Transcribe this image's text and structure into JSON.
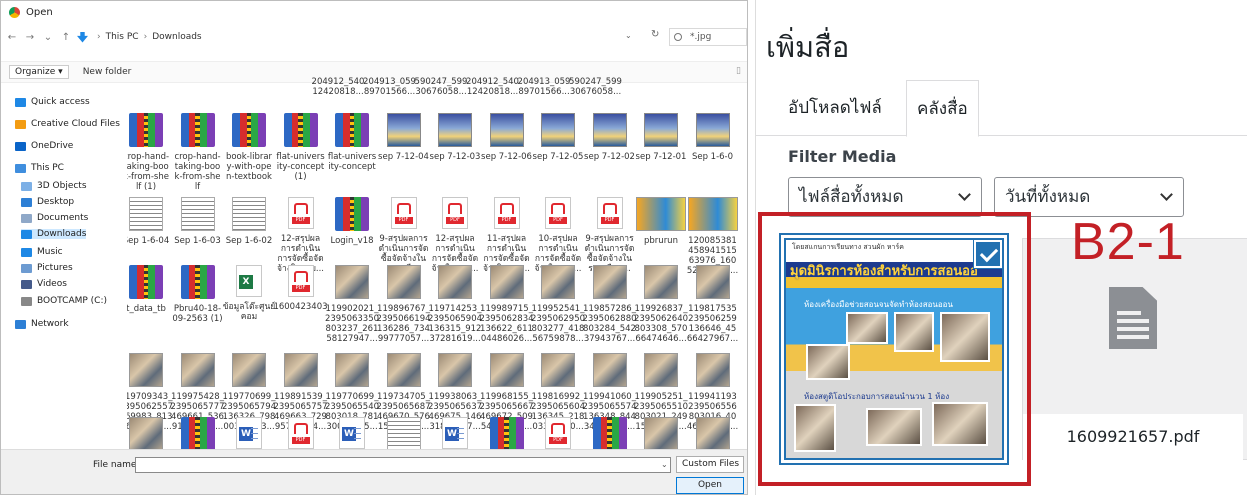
{
  "dialog": {
    "title": "Open",
    "address": [
      "This PC",
      "Downloads"
    ],
    "search_placeholder": "*.jpg",
    "organize": "Organize ▾",
    "new_folder": "New folder",
    "file_name_label": "File name:",
    "file_name_value": "",
    "file_type": "Custom Files",
    "open_button": "Open"
  },
  "nav": [
    {
      "label": "Quick access",
      "icon": "star-icon",
      "color": "#1e88e5"
    },
    {
      "label": "Creative Cloud Files",
      "icon": "cloud-files-icon",
      "color": "#f39c12"
    },
    {
      "label": "OneDrive",
      "icon": "onedrive-icon",
      "color": "#0a64c8"
    },
    {
      "label": "This PC",
      "icon": "computer-icon",
      "color": "#3f8ede"
    },
    {
      "label": "3D Objects",
      "icon": "cube-icon",
      "color": "#7db0e6"
    },
    {
      "label": "Desktop",
      "icon": "desktop-icon",
      "color": "#2d7fd5"
    },
    {
      "label": "Documents",
      "icon": "documents-icon",
      "color": "#8fa8c8"
    },
    {
      "label": "Downloads",
      "icon": "downloads-icon",
      "color": "#1e88e5"
    },
    {
      "label": "Music",
      "icon": "music-icon",
      "color": "#1e88e5"
    },
    {
      "label": "Pictures",
      "icon": "pictures-icon",
      "color": "#6d9bd1"
    },
    {
      "label": "Videos",
      "icon": "videos-icon",
      "color": "#455a8a"
    },
    {
      "label": "BOOTCAMP (C:)",
      "icon": "drive-icon",
      "color": "#888888"
    },
    {
      "label": "Network",
      "icon": "network-icon",
      "color": "#2d7fd5"
    }
  ],
  "files_top_partial": [
    "204912_540\n12420818...",
    "204913_059\n89701566...",
    "590247_599\n30676058...",
    "204912_540\n12420818...",
    "204913_059\n89701566...",
    "590247_599\n30676058..."
  ],
  "files": [
    [
      {
        "name": "crop-hand-\ntaking-boo\nk-from-she\nlf (1)",
        "type": "rar"
      },
      {
        "name": "crop-hand-\ntaking-boo\nk-from-she\nlf",
        "type": "rar"
      },
      {
        "name": "book-librar\ny-with-ope\nn-textbook",
        "type": "rar"
      },
      {
        "name": "flat-univers\nity-concept\n(1)",
        "type": "rar"
      },
      {
        "name": "flat-univers\nity-concept",
        "type": "rar"
      },
      {
        "name": "sep 7-12-04",
        "type": "poster"
      },
      {
        "name": "sep 7-12-03",
        "type": "poster"
      },
      {
        "name": "sep 7-12-06",
        "type": "poster"
      },
      {
        "name": "sep 7-12-05",
        "type": "poster"
      },
      {
        "name": "sep 7-12-02",
        "type": "poster"
      },
      {
        "name": "sep 7-12-01",
        "type": "poster"
      },
      {
        "name": "Sep 1-6-0",
        "type": "poster"
      }
    ],
    [
      {
        "name": "Sep 1-6-04",
        "type": "doc"
      },
      {
        "name": "Sep 1-6-03",
        "type": "doc"
      },
      {
        "name": "Sep 1-6-02",
        "type": "doc"
      },
      {
        "name": "12-สรุปผล\nการดำเนิน\nการจัดซื้อจัด\nจ้างในรอบ...",
        "type": "pdf"
      },
      {
        "name": "Login_v18",
        "type": "rar"
      },
      {
        "name": "9-สรุปผลการ\nดำเนินการจัด\nซื้อจัดจ้างใน\nรอบเดื...",
        "type": "pdf"
      },
      {
        "name": "12-สรุปผล\nการดำเนิน\nการจัดซื้อจัด\nจ้างในรอบ...",
        "type": "pdf"
      },
      {
        "name": "11-สรุปผล\nการดำเนิน\nการจัดซื้อจัด\nจ้างในรอบ...",
        "type": "pdf"
      },
      {
        "name": "10-สรุปผล\nการดำเนิน\nการจัดซื้อจัด\nจ้างในรอบ...",
        "type": "pdf"
      },
      {
        "name": "9-สรุปผลการ\nดำเนินการจัด\nซื้อจัดจ้างใน\nรอบเดือน...",
        "type": "pdf"
      },
      {
        "name": "pbrurun",
        "type": "banner"
      },
      {
        "name": "120085381\n458941515\n63976_160\n52236138...",
        "type": "banner"
      }
    ],
    [
      {
        "name": "t_data_tb",
        "type": "rar"
      },
      {
        "name": "Pbru40-18-\n09-2563 (1)",
        "type": "rar"
      },
      {
        "name": "ข้อมูลโต๊ะศูนย์\nคอม",
        "type": "excel"
      },
      {
        "name": "1600423403",
        "type": "pdf"
      },
      {
        "name": "119902021_\n2395063350\n803237_261\n58127947...",
        "type": "photo"
      },
      {
        "name": "119896767_\n2395066194\n136286_734\n99777057...",
        "type": "photo"
      },
      {
        "name": "119714253_\n2395065904\n136315_912\n37281619...",
        "type": "photo"
      },
      {
        "name": "119989715_\n2395062834\n136622_611\n04486026...",
        "type": "photo"
      },
      {
        "name": "119952541_\n2395062950\n803277_418\n56759878...",
        "type": "photo"
      },
      {
        "name": "119857286_\n2395062880\n803284_542\n37943767...",
        "type": "photo"
      },
      {
        "name": "119926837_\n2395062640\n803308_570\n66474646...",
        "type": "photo"
      },
      {
        "name": "119817535\n239506259\n136646_45\n66427967...",
        "type": "photo"
      }
    ],
    [
      {
        "name": "119709343_\n2395062557\n469983_813\n46101238...",
        "type": "photo"
      },
      {
        "name": "119975428_\n2395065777\n469661_536\n91043635...",
        "type": "photo"
      },
      {
        "name": "119770699_\n2395065794\n136326_798\n00336293...",
        "type": "photo"
      },
      {
        "name": "119891539_\n2395065757\n469663_729\n95788224...",
        "type": "photo"
      },
      {
        "name": "119770699_\n2395065540\n803018_781\n30004555...",
        "type": "photo"
      },
      {
        "name": "119734705_\n2395065687\n469670_576\n15368216...",
        "type": "photo"
      },
      {
        "name": "119938063_\n2395065637\n469675_146\n31880837...",
        "type": "photo"
      },
      {
        "name": "119968155_\n2395065667\n469672_509\n54271096...",
        "type": "photo"
      },
      {
        "name": "119816992_\n2395065604\n136345_218\n03313450...",
        "type": "photo"
      },
      {
        "name": "119941060_\n2395065574\n136348_844\n34182650...",
        "type": "photo"
      },
      {
        "name": "119905251_\n2395065510\n803021_249\n15874061...",
        "type": "photo"
      },
      {
        "name": "119941193\n239506556\n803016_40\n46117992...",
        "type": "photo"
      }
    ],
    [
      {
        "name": "",
        "type": "photo"
      },
      {
        "name": "",
        "type": "rar"
      },
      {
        "name": "",
        "type": "word"
      },
      {
        "name": "",
        "type": "pdf"
      },
      {
        "name": "",
        "type": "word"
      },
      {
        "name": "",
        "type": "doc"
      },
      {
        "name": "",
        "type": "word"
      },
      {
        "name": "",
        "type": "rar"
      },
      {
        "name": "",
        "type": "pdf"
      },
      {
        "name": "",
        "type": "rar"
      },
      {
        "name": "",
        "type": "photo"
      },
      {
        "name": "",
        "type": "photo"
      }
    ]
  ],
  "wp": {
    "title": "เพิ่มสื่อ",
    "tabs": [
      "อัปโหลดไฟล์",
      "คลังสื่อ"
    ],
    "filter_label": "Filter Media",
    "filter_type": "ไฟล์สื่อทั้งหมด",
    "filter_date": "วันที่ทั้งหมด",
    "poster_line1": "โดยสแกนการเรียนทาง สวนผัก หาร์ค",
    "poster_title": "มุดมินิรการห้องสำหรับการสอนออ",
    "poster_line3": "ห้องเครื่องมือช่วยสอนจนจัดทำห้องสอนออน",
    "poster_line4": "ห้องสตูดิโอประกอบการสอนนำนวน 1 ห้อง",
    "pdf_name": "1609921657.pdf",
    "annotation": "B2-1",
    "accent": "#2271b1",
    "annotation_color": "#c32026"
  }
}
